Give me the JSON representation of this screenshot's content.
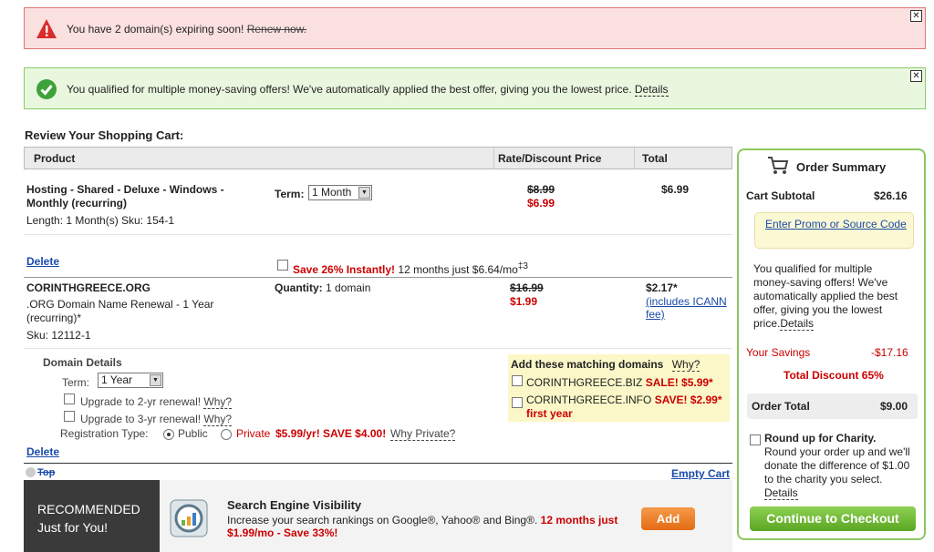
{
  "alerts": {
    "error": {
      "text": "You have 2 domain(s) expiring soon!",
      "link": "Renew now."
    },
    "success": {
      "text": "You qualified for multiple money-saving offers! We've automatically applied the best offer, giving you the lowest price.",
      "link": "Details"
    }
  },
  "cart": {
    "title": "Review Your Shopping Cart:",
    "headers": {
      "product": "Product",
      "rate": "Rate/Discount Price",
      "total": "Total"
    },
    "item1": {
      "name": "Hosting - Shared - Deluxe - Windows - Monthly (recurring)",
      "meta": "Length: 1 Month(s) Sku: 154-1",
      "term_label": "Term:",
      "term_value": "1 Month",
      "old_price": "$8.99",
      "new_price": "$6.99",
      "total": "$6.99",
      "delete": "Delete",
      "save_offer": "Save 26% Instantly!",
      "save_detail": "12 months just $6.64/mo",
      "save_note": "‡3"
    },
    "item2": {
      "name": "CORINTHGREECE.ORG",
      "desc": ".ORG Domain Name Renewal - 1 Year (recurring)*",
      "sku": "Sku: 12112-1",
      "quantity_label": "Quantity:",
      "quantity_value": "1 domain",
      "old_price": "$16.99",
      "new_price": "$1.99",
      "total": "$2.17*",
      "icann": "(includes ICANN fee)",
      "details_title": "Domain Details",
      "term_label": "Term:",
      "term_value": "1 Year",
      "upgrade2": "Upgrade to 2-yr renewal!",
      "upgrade3": "Upgrade to 3-yr renewal!",
      "why": "Why?",
      "reg_label": "Registration Type:",
      "reg_public": "Public",
      "reg_private": "Private",
      "reg_private_price": "$5.99/yr! SAVE $4.00!",
      "why_private": "Why Private?",
      "delete": "Delete"
    },
    "matching": {
      "title": "Add these matching domains",
      "why": "Why?",
      "d1_name": "CORINTHGREECE.BIZ",
      "d1_offer": "SALE! $5.99*",
      "d2_name": "CORINTHGREECE.INFO",
      "d2_offer": "SAVE! $2.99*",
      "d2_note": "first year"
    },
    "top": "Top",
    "empty": "Empty Cart"
  },
  "recommended": {
    "label_line1": "RECOMMENDED",
    "label_line2": "Just for You!",
    "title": "Search Engine Visibility",
    "desc": "Increase your search rankings on Google®, Yahoo® and Bing®.",
    "offer": "12 months just $1.99/mo - Save 33%!",
    "add": "Add"
  },
  "summary": {
    "title": "Order Summary",
    "subtotal_label": "Cart Subtotal",
    "subtotal_value": "$26.16",
    "promo": "Enter Promo or Source Code",
    "qualified_text": "You qualified for multiple money-saving offers! We've automatically applied the best offer, giving you the lowest price.",
    "details": "Details",
    "savings_label": "Your Savings",
    "savings_value": "-$17.16",
    "discount": "Total Discount 65%",
    "total_label": "Order Total",
    "total_value": "$9.00",
    "charity_title": "Round up for Charity.",
    "charity_text": "Round your order up and we'll donate the difference of $1.00 to the charity you select.",
    "charity_details": "Details",
    "checkout": "Continue to Checkout"
  },
  "colors": {
    "accent_green": "#8cc860",
    "link_blue": "#1a4aa8",
    "sale_red": "#cc0000",
    "add_orange": "#e46c12"
  }
}
